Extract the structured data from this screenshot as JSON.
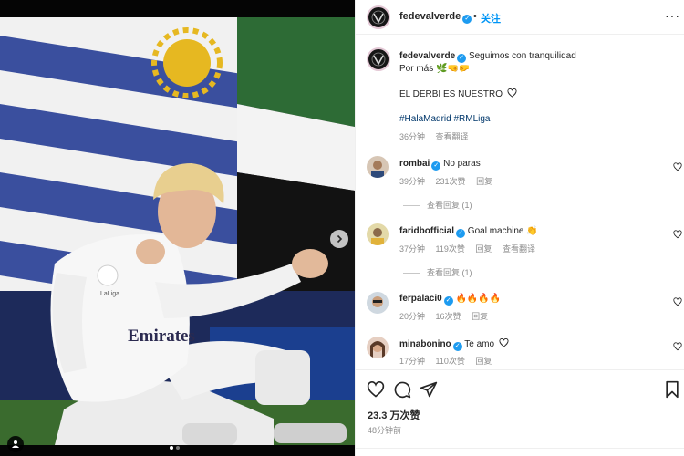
{
  "post": {
    "author": "fedevalverde",
    "follow_label": "关注",
    "separator": "•",
    "more_label": "···",
    "caption_line1": "Seguimos con tranquilidad",
    "caption_line2": "Por más 🌿🤜🤛",
    "caption_line3": "EL DERBI ES NUESTRO",
    "hashtags": "#HalaMadrid #RMLiga",
    "time": "36分钟",
    "translate_label": "查看翻译",
    "likes": "23.3 万次赞",
    "date": "48分钟前",
    "photo_jersey_text": "Emirates",
    "photo_badge_text": "LaLiga"
  },
  "comments": [
    {
      "user": "rombai",
      "text": "No paras",
      "time": "39分钟",
      "likes": "231次赞",
      "reply": "回复",
      "replies_label": "查看回复 (1)"
    },
    {
      "user": "faridbofficial",
      "text": "Goal machine 👏",
      "time": "37分钟",
      "likes": "119次赞",
      "reply": "回复",
      "translate": "查看翻译",
      "replies_label": "查看回复 (1)"
    },
    {
      "user": "ferpalaci0",
      "text": "🔥🔥🔥🔥",
      "time": "20分钟",
      "likes": "16次赞",
      "reply": "回复"
    },
    {
      "user": "minabonino",
      "text": "Te amo",
      "time": "17分钟",
      "likes": "110次赞",
      "reply": "回复"
    }
  ],
  "colors": {
    "link_blue": "#0095f6",
    "verified_blue": "#1d9bf0",
    "hashtag": "#00376b",
    "meta_gray": "#8e8e8e"
  },
  "icons": [
    "like-icon",
    "comment-icon",
    "share-icon",
    "save-icon",
    "tag-icon",
    "next-icon",
    "verified-icon",
    "more-icon",
    "heart-icon"
  ]
}
